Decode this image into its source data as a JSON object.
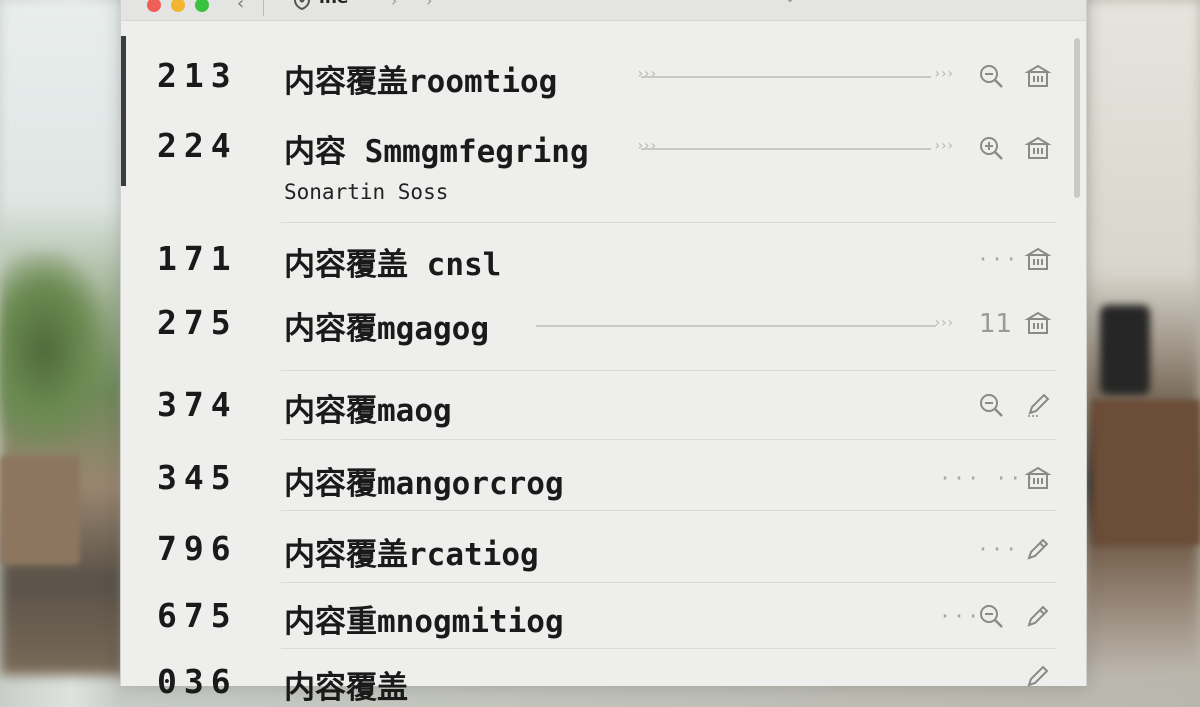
{
  "window": {
    "title": "ine",
    "back_glyph": "‹",
    "forward_glyphs": [
      "›",
      "›"
    ],
    "more_glyph": "···"
  },
  "rows": [
    {
      "number": "213",
      "title": "内容覆盖roomtiog",
      "subtitle": "",
      "actions": [
        "search-icon",
        "archive-icon"
      ],
      "dots": "",
      "count": ""
    },
    {
      "number": "224",
      "title": "内容 Smmgmfegring",
      "subtitle": "Sonartin Soss",
      "actions": [
        "search-icon",
        "archive-icon"
      ],
      "dots": "",
      "count": ""
    },
    {
      "number": "171",
      "title": "内容覆盖 cnsl",
      "subtitle": "",
      "actions": [
        "archive-icon"
      ],
      "dots": "···",
      "count": ""
    },
    {
      "number": "275",
      "title": "内容覆mgagog",
      "subtitle": "",
      "actions": [
        "archive-icon"
      ],
      "dots": "",
      "count": "11"
    },
    {
      "number": "374",
      "title": "内容覆maog",
      "subtitle": "",
      "actions": [
        "search-icon",
        "edit-icon"
      ],
      "dots": "",
      "count": ""
    },
    {
      "number": "345",
      "title": "内容覆mangorcrog",
      "subtitle": "",
      "actions": [
        "archive-icon"
      ],
      "dots": "··· ···",
      "count": ""
    },
    {
      "number": "796",
      "title": "内容覆盖rcatiog",
      "subtitle": "",
      "actions": [
        "edit-icon"
      ],
      "dots": "···",
      "count": ""
    },
    {
      "number": "675",
      "title": "内容重mnogmitiog",
      "subtitle": "",
      "actions": [
        "search-icon",
        "edit-icon"
      ],
      "dots": "···",
      "count": ""
    },
    {
      "number": "036",
      "title": "内容覆盖",
      "subtitle": "",
      "actions": [
        "edit-icon"
      ],
      "dots": "",
      "count": ""
    }
  ]
}
